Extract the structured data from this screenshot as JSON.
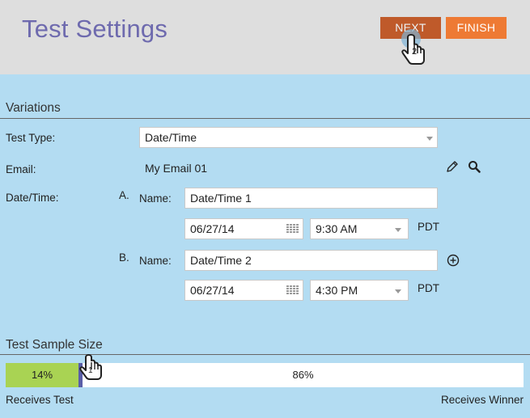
{
  "header": {
    "title": "Test Settings",
    "next_label": "NEXT",
    "finish_label": "FINISH",
    "next_badge": "2"
  },
  "variations": {
    "section_title": "Variations",
    "test_type_label": "Test Type:",
    "test_type_value": "Date/Time",
    "email_label": "Email:",
    "email_value": "My Email 01",
    "datetime_label": "Date/Time:",
    "items": [
      {
        "letter": "A.",
        "name_label": "Name:",
        "name_value": "Date/Time 1",
        "date": "06/27/14",
        "time": "9:30 AM",
        "tz": "PDT"
      },
      {
        "letter": "B.",
        "name_label": "Name:",
        "name_value": "Date/Time 2",
        "date": "06/27/14",
        "time": "4:30 PM",
        "tz": "PDT"
      }
    ]
  },
  "sample_size": {
    "section_title": "Test Sample Size",
    "test_percent": "14%",
    "winner_percent": "86%",
    "test_fraction": 0.14,
    "receives_test_label": "Receives Test",
    "receives_winner_label": "Receives Winner",
    "cursor_badge": "1"
  },
  "icons": [
    "pencil-icon",
    "search-icon",
    "plus-circle-icon",
    "calendar-icon",
    "hand-cursor-icon"
  ],
  "colors": {
    "title": "#6e6aae",
    "next": "#bf5a2a",
    "finish": "#ee7a34",
    "panel": "#b3dcf2",
    "header": "#dedede",
    "bar_fill": "#a9d353",
    "handle": "#5a5ea8"
  }
}
